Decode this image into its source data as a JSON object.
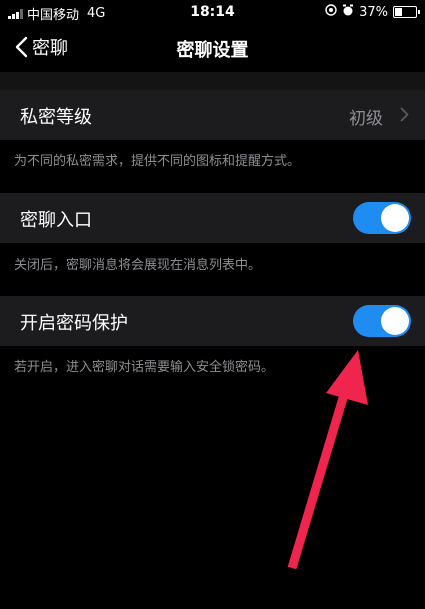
{
  "status_bar": {
    "carrier": "中国移动",
    "network": "4G",
    "time": "18:14",
    "battery_percent": "37%",
    "battery_level": 0.37
  },
  "nav": {
    "back_label": "密聊",
    "title": "密聊设置"
  },
  "settings": {
    "privacy_level": {
      "label": "私密等级",
      "value": "初级",
      "description": "为不同的私密需求，提供不同的图标和提醒方式。"
    },
    "chat_entry": {
      "label": "密聊入口",
      "enabled": true,
      "description": "关闭后，密聊消息将会展现在消息列表中。"
    },
    "password_protect": {
      "label": "开启密码保护",
      "enabled": true,
      "description": "若开启，进入密聊对话需要输入安全锁密码。"
    }
  },
  "colors": {
    "toggle_on": "#1e8cf0",
    "annotation_arrow": "#f0254d"
  }
}
